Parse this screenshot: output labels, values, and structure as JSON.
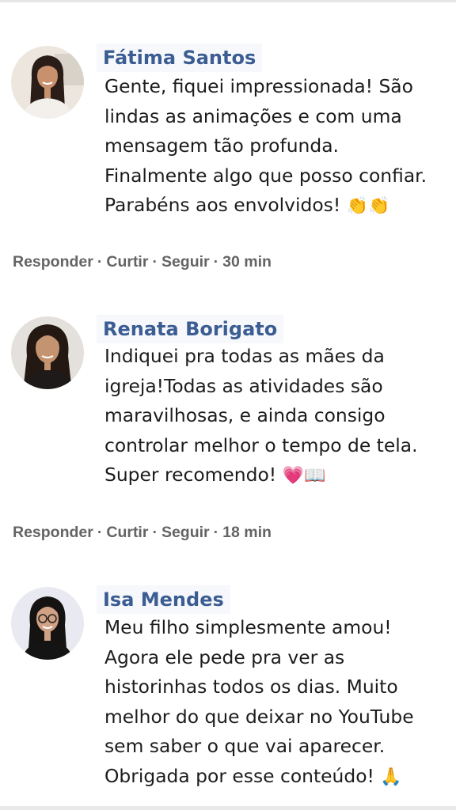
{
  "comments": [
    {
      "author": "Fátima Santos",
      "text": "Gente, fiquei impressionada! São\nlindas as animações e com uma\nmensagem tão profunda.\nFinalmente algo que posso confiar.\nParabéns aos envolvidos! ",
      "emoji": "👏👏",
      "actions": {
        "reply": "Responder",
        "like": "Curtir",
        "follow": "Seguir",
        "time": "30 min"
      }
    },
    {
      "author": "Renata Borigato",
      "text": "Indiquei pra todas as mães da\nigreja!Todas as atividades são\nmaravilhosas, e ainda consigo\ncontrolar melhor o tempo de tela.\nSuper recomendo! ",
      "emoji": "💗📖",
      "actions": {
        "reply": "Responder",
        "like": "Curtir",
        "follow": "Seguir",
        "time": "18 min"
      }
    },
    {
      "author": "Isa Mendes",
      "text": "Meu filho simplesmente amou!\nAgora ele pede pra ver as\nhistorinhas todos os dias. Muito\nmelhor do que deixar no YouTube\nsem saber o que vai aparecer.\nObrigada por esse conteúdo! ",
      "emoji": "🙏"
    }
  ],
  "separator": "·",
  "colors": {
    "author": "#3b5d93",
    "text": "#1c1c1c",
    "actions": "#646464"
  }
}
